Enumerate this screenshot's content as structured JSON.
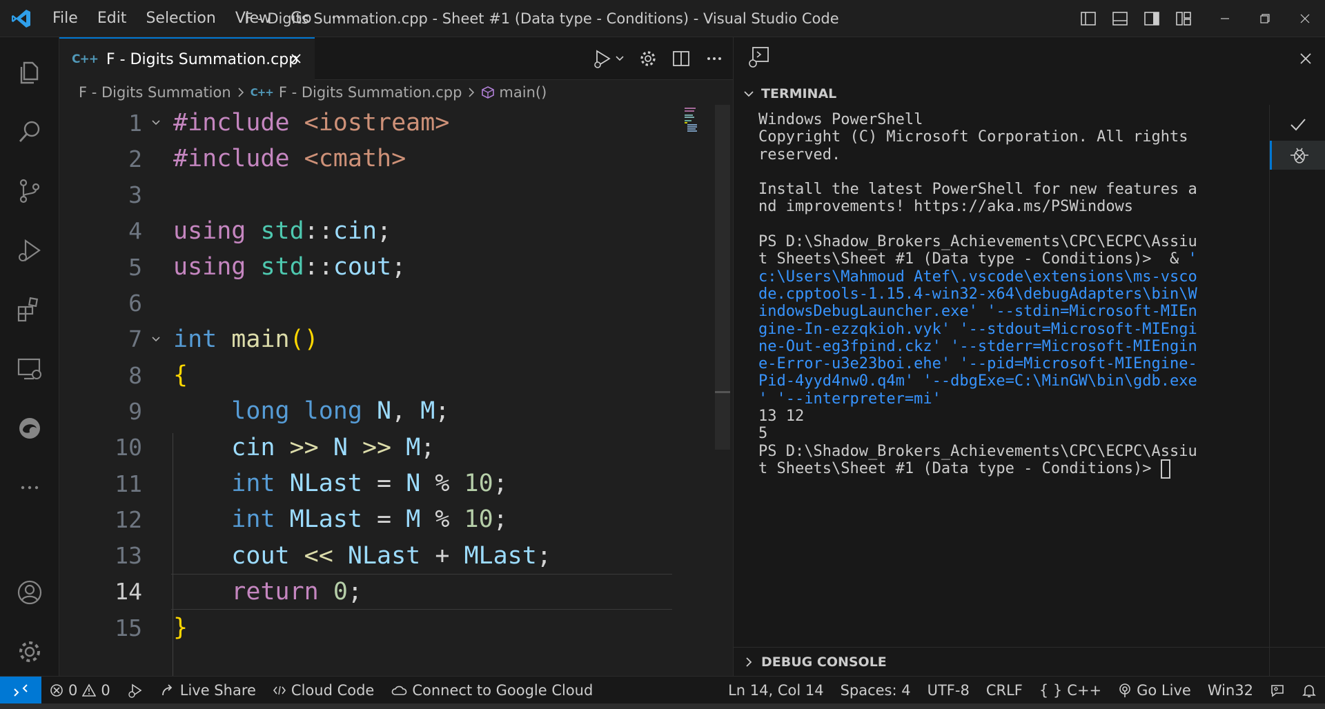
{
  "titlebar": {
    "menu": [
      "File",
      "Edit",
      "Selection",
      "View",
      "Go",
      "···"
    ],
    "title": "F - Digits Summation.cpp - Sheet #1 (Data type - Conditions) - Visual Studio Code"
  },
  "tab": {
    "label": "F - Digits Summation.cpp",
    "badge": "C++"
  },
  "breadcrumb": {
    "folder": "F - Digits Summation",
    "file": "F - Digits Summation.cpp",
    "symbol": "main()"
  },
  "code": {
    "lines": [
      {
        "n": "1",
        "tokens": [
          [
            "k-pre",
            "#include "
          ],
          [
            "k-inc",
            "<iostream>"
          ]
        ]
      },
      {
        "n": "2",
        "tokens": [
          [
            "k-pre",
            "#include "
          ],
          [
            "k-inc",
            "<cmath>"
          ]
        ]
      },
      {
        "n": "3",
        "tokens": []
      },
      {
        "n": "4",
        "tokens": [
          [
            "k-ctl",
            "using "
          ],
          [
            "k-ns",
            "std"
          ],
          [
            "k-op",
            "::"
          ],
          [
            "k-var",
            "cin"
          ],
          [
            "k-op",
            ";"
          ]
        ]
      },
      {
        "n": "5",
        "tokens": [
          [
            "k-ctl",
            "using "
          ],
          [
            "k-ns",
            "std"
          ],
          [
            "k-op",
            "::"
          ],
          [
            "k-var",
            "cout"
          ],
          [
            "k-op",
            ";"
          ]
        ]
      },
      {
        "n": "6",
        "tokens": []
      },
      {
        "n": "7",
        "tokens": [
          [
            "k-type",
            "int "
          ],
          [
            "k-fn",
            "main"
          ],
          [
            "k-br1",
            "()"
          ]
        ]
      },
      {
        "n": "8",
        "tokens": [
          [
            "k-br1",
            "{"
          ]
        ]
      },
      {
        "n": "9",
        "tokens": [
          [
            "k-plain",
            "    "
          ],
          [
            "k-type",
            "long long "
          ],
          [
            "k-var",
            "N"
          ],
          [
            "k-op",
            ", "
          ],
          [
            "k-var",
            "M"
          ],
          [
            "k-op",
            ";"
          ]
        ]
      },
      {
        "n": "10",
        "tokens": [
          [
            "k-plain",
            "    "
          ],
          [
            "k-var",
            "cin "
          ],
          [
            "k-fn",
            ">> "
          ],
          [
            "k-var",
            "N "
          ],
          [
            "k-fn",
            ">> "
          ],
          [
            "k-var",
            "M"
          ],
          [
            "k-op",
            ";"
          ]
        ]
      },
      {
        "n": "11",
        "tokens": [
          [
            "k-plain",
            "    "
          ],
          [
            "k-type",
            "int "
          ],
          [
            "k-var",
            "NLast "
          ],
          [
            "k-op",
            "= "
          ],
          [
            "k-var",
            "N "
          ],
          [
            "k-op",
            "% "
          ],
          [
            "k-num",
            "10"
          ],
          [
            "k-op",
            ";"
          ]
        ]
      },
      {
        "n": "12",
        "tokens": [
          [
            "k-plain",
            "    "
          ],
          [
            "k-type",
            "int "
          ],
          [
            "k-var",
            "MLast "
          ],
          [
            "k-op",
            "= "
          ],
          [
            "k-var",
            "M "
          ],
          [
            "k-op",
            "% "
          ],
          [
            "k-num",
            "10"
          ],
          [
            "k-op",
            ";"
          ]
        ]
      },
      {
        "n": "13",
        "tokens": [
          [
            "k-plain",
            "    "
          ],
          [
            "k-var",
            "cout "
          ],
          [
            "k-fn",
            "<< "
          ],
          [
            "k-var",
            "NLast "
          ],
          [
            "k-op",
            "+ "
          ],
          [
            "k-var",
            "MLast"
          ],
          [
            "k-op",
            ";"
          ]
        ]
      },
      {
        "n": "14",
        "tokens": [
          [
            "k-plain",
            "    "
          ],
          [
            "k-ctl",
            "return "
          ],
          [
            "k-num",
            "0"
          ],
          [
            "k-op",
            ";"
          ]
        ]
      },
      {
        "n": "15",
        "tokens": [
          [
            "k-br1",
            "}"
          ]
        ]
      }
    ]
  },
  "panel": {
    "terminal_title": "TERMINAL",
    "debug_console_title": "DEBUG CONSOLE",
    "terminal_lines": [
      {
        "cls": "",
        "text": "Windows PowerShell"
      },
      {
        "cls": "",
        "text": "Copyright (C) Microsoft Corporation. All rights"
      },
      {
        "cls": "",
        "text": "reserved."
      },
      {
        "cls": "",
        "text": ""
      },
      {
        "cls": "",
        "text": "Install the latest PowerShell for new features a"
      },
      {
        "cls": "",
        "text": "nd improvements! https://aka.ms/PSWindows"
      },
      {
        "cls": "",
        "text": ""
      },
      {
        "cls": "",
        "text": "PS D:\\Shadow_Brokers_Achievements\\CPC\\ECPC\\Assiu"
      },
      {
        "cls": "mixed",
        "text": "t Sheets\\Sheet #1 (Data type - Conditions)>  & ",
        "cmd": "'"
      },
      {
        "cls": "t-cmd",
        "text": "c:\\Users\\Mahmoud Atef\\.vscode\\extensions\\ms-vsco"
      },
      {
        "cls": "t-cmd",
        "text": "de.cpptools-1.15.4-win32-x64\\debugAdapters\\bin\\W"
      },
      {
        "cls": "t-cmd",
        "text": "indowsDebugLauncher.exe' '--stdin=Microsoft-MIEn"
      },
      {
        "cls": "t-cmd",
        "text": "gine-In-ezzqkioh.vyk' '--stdout=Microsoft-MIEngi"
      },
      {
        "cls": "t-cmd",
        "text": "ne-Out-eg3fpind.ckz' '--stderr=Microsoft-MIEngin"
      },
      {
        "cls": "t-cmd",
        "text": "e-Error-u3e23boi.ehe' '--pid=Microsoft-MIEngine-"
      },
      {
        "cls": "t-cmd",
        "text": "Pid-4yyd4nw0.q4m' '--dbgExe=C:\\MinGW\\bin\\gdb.exe"
      },
      {
        "cls": "t-cmd",
        "text": "' '--interpreter=mi'"
      },
      {
        "cls": "",
        "text": "13 12"
      },
      {
        "cls": "",
        "text": "5"
      },
      {
        "cls": "",
        "text": "PS D:\\Shadow_Brokers_Achievements\\CPC\\ECPC\\Assiu"
      },
      {
        "cls": "prompt",
        "text": "t Sheets\\Sheet #1 (Data type - Conditions)> "
      }
    ]
  },
  "statusbar": {
    "problems_errors": "0",
    "problems_warnings": "0",
    "live_share": "Live Share",
    "cloud_code": "Cloud Code",
    "google_cloud": "Connect to Google Cloud",
    "position": "Ln 14, Col 14",
    "spaces": "Spaces: 4",
    "encoding": "UTF-8",
    "eol": "CRLF",
    "language_braces": "{ }",
    "language": "C++",
    "go_live": "Go Live",
    "platform": "Win32"
  },
  "colors": {
    "accent": "#0078d4",
    "background": "#1f1f1f",
    "sidebar": "#181818"
  }
}
